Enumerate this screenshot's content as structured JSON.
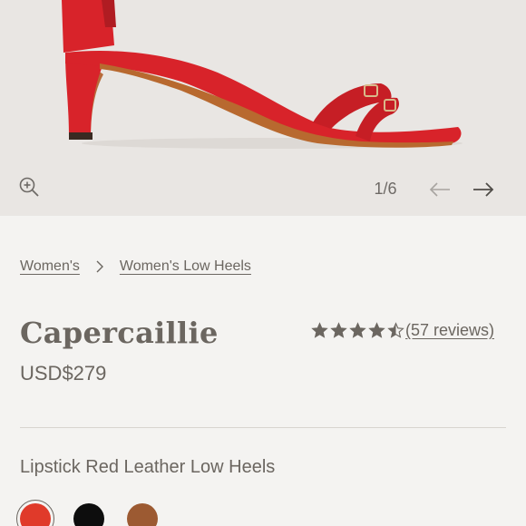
{
  "gallery": {
    "image_counter": "1/6",
    "icons": {
      "zoom": "zoom-in-icon",
      "prev": "arrow-left-icon",
      "next": "arrow-right-icon"
    }
  },
  "breadcrumb": {
    "items": [
      {
        "label": "Women's"
      },
      {
        "label": "Women's Low Heels"
      }
    ],
    "separator_icon": "chevron-right-icon"
  },
  "product": {
    "name": "Capercaillie",
    "price": "USD$279",
    "rating": 4.5,
    "rating_max": 5,
    "reviews_label": "(57 reviews)",
    "variant_name": "Lipstick Red Leather Low Heels"
  },
  "swatches": [
    {
      "color": "#e03a2a",
      "selected": true
    },
    {
      "color": "#0d0d0d",
      "selected": false
    },
    {
      "color": "#9c5a32",
      "selected": false
    }
  ],
  "colors": {
    "text": "#6b6660",
    "gallery_bg": "#e9e6e3",
    "page_bg": "#f4f3f1",
    "shoe_red": "#d8232a"
  }
}
